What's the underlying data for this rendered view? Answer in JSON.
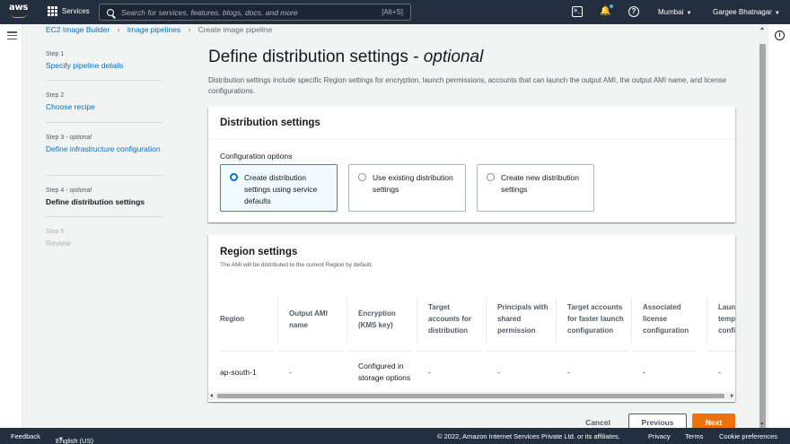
{
  "topnav": {
    "logo": "aws",
    "services_label": "Services",
    "search_placeholder": "Search for services, features, blogs, docs, and more",
    "search_shortcut": "[Alt+S]",
    "region": "Mumbai",
    "account": "Gargee Bhatnagar"
  },
  "breadcrumb": {
    "items": [
      "EC2 Image Builder",
      "Image pipelines"
    ],
    "current": "Create image pipeline"
  },
  "steps": [
    {
      "num": "Step 1",
      "optional": "",
      "title": "Specify pipeline details",
      "state": "link"
    },
    {
      "num": "Step 2",
      "optional": "",
      "title": "Choose recipe",
      "state": "link"
    },
    {
      "num": "Step 3 - ",
      "optional": "optional",
      "title": "Define infrastructure configuration",
      "state": "link"
    },
    {
      "num": "Step 4 - ",
      "optional": "optional",
      "title": "Define distribution settings",
      "state": "active"
    },
    {
      "num": "Step 5",
      "optional": "",
      "title": "Review",
      "state": "disabled"
    }
  ],
  "page": {
    "title": "Define distribution settings - ",
    "title_optional": "optional",
    "description": "Distribution settings include specific Region settings for encryption, launch permissions, accounts that can launch the output AMI, the output AMI name, and license configurations."
  },
  "distribution": {
    "header": "Distribution settings",
    "config_label": "Configuration options",
    "options": [
      {
        "label": "Create distribution settings using service defaults",
        "selected": true
      },
      {
        "label": "Use existing distribution settings",
        "selected": false
      },
      {
        "label": "Create new distribution settings",
        "selected": false
      }
    ]
  },
  "region_settings": {
    "header": "Region settings",
    "subtitle": "The AMI will be distributed to the current Region by default.",
    "columns": [
      "Region",
      "Output AMI name",
      "Encryption (KMS key)",
      "Target accounts for distribution",
      "Principals with shared permission",
      "Target accounts for faster launch configuration",
      "Associated license configuration",
      "Launch template configuration"
    ],
    "rows": [
      [
        "ap-south-1",
        "-",
        "Configured in storage options",
        "-",
        "-",
        "-",
        "-",
        "-"
      ]
    ]
  },
  "actions": {
    "cancel": "Cancel",
    "previous": "Previous",
    "next": "Next"
  },
  "footer": {
    "feedback": "Feedback",
    "language": "English (US)",
    "copyright": "© 2022, Amazon Internet Services Private Ltd. or its affiliates.",
    "privacy": "Privacy",
    "terms": "Terms",
    "cookies": "Cookie preferences"
  },
  "colors": {
    "nav_bg": "#232f3e",
    "link": "#0073bb",
    "primary_button": "#ec7211",
    "selected_tile_border": "#00a1c9"
  }
}
